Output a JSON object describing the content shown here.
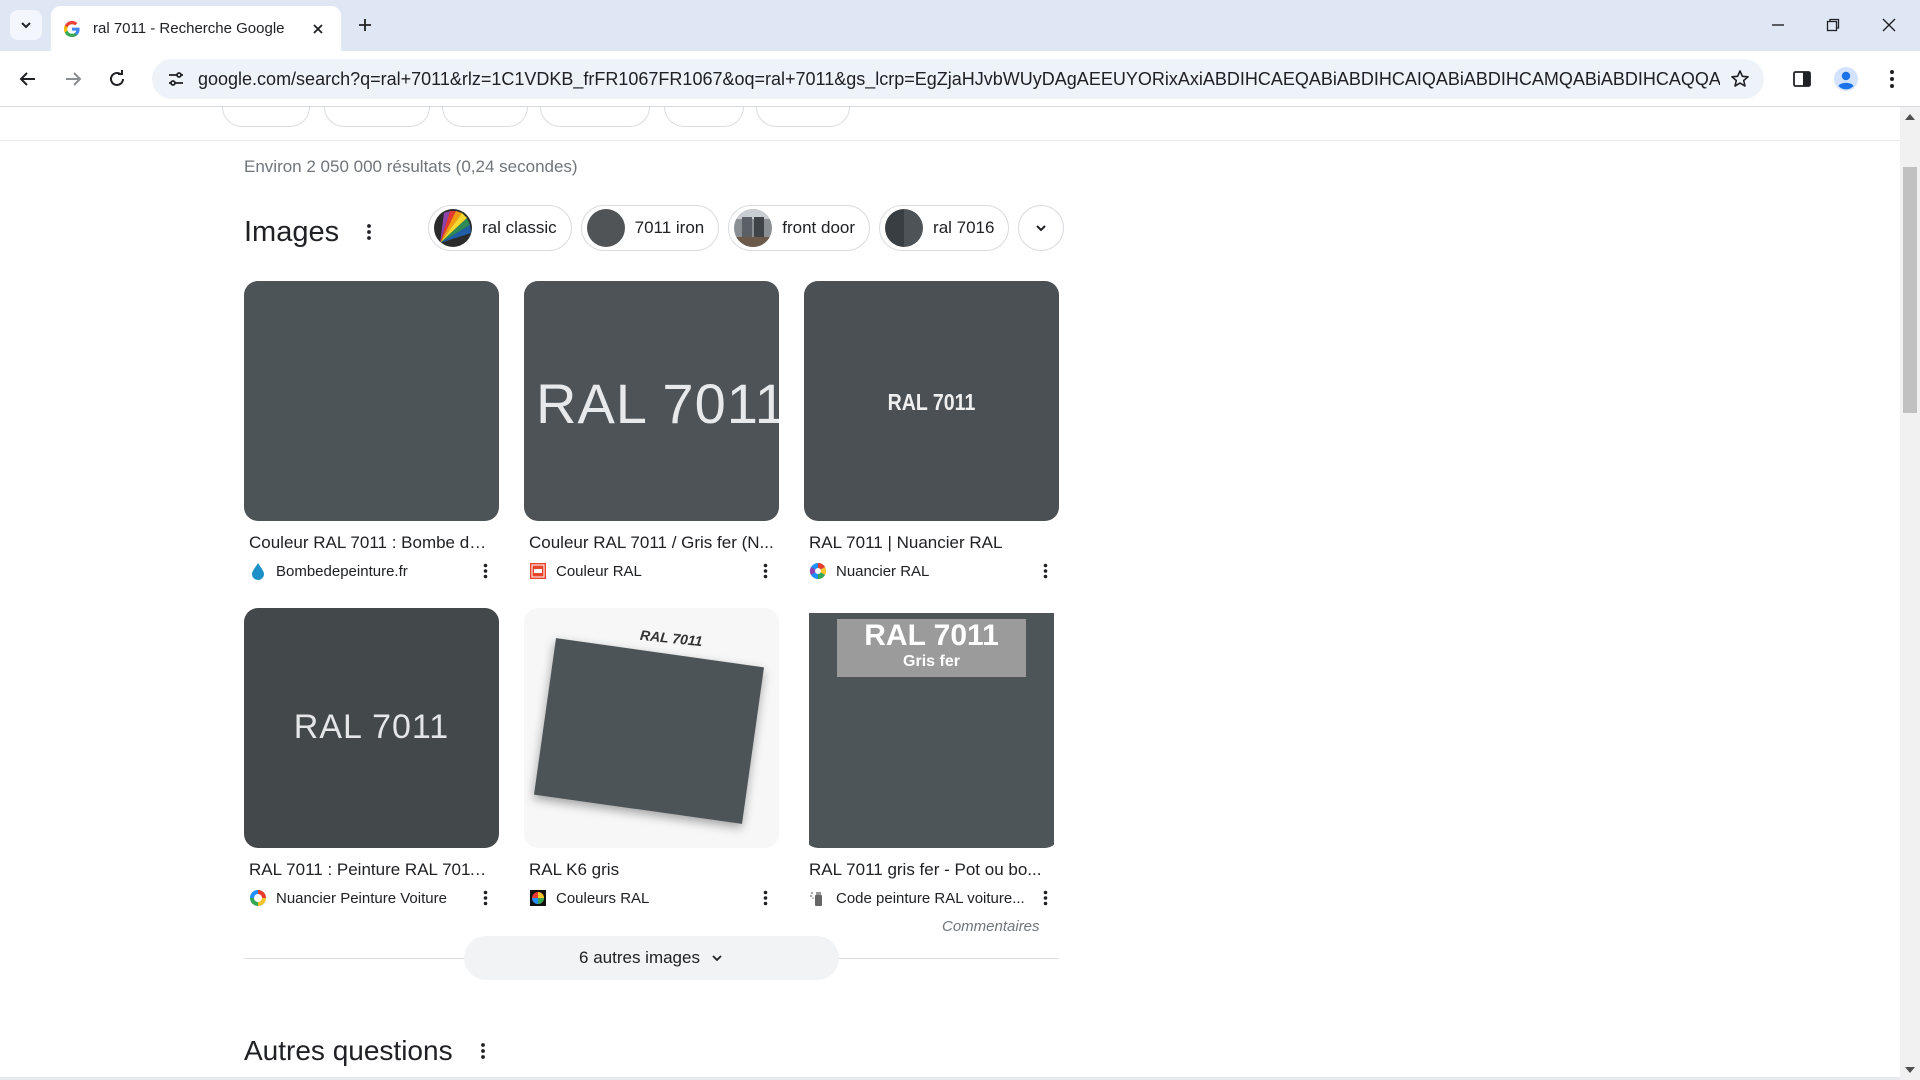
{
  "browser": {
    "tab_title": "ral 7011 - Recherche Google",
    "url": "google.com/search?q=ral+7011&rlz=1C1VDKB_frFR1067FR1067&oq=ral+7011&gs_lcrp=EgZjaHJvbWUyDAgAEEUYORixAxiABDIHCAEQABiABDIHCAIQABiABDIHCAMQABiABDIHCAQQABiABDIHCA..."
  },
  "results": {
    "stats": "Environ 2 050 000 résultats (0,24 secondes)"
  },
  "images": {
    "title": "Images",
    "chips": [
      {
        "label": "ral classic"
      },
      {
        "label": "7011 iron"
      },
      {
        "label": "front door"
      },
      {
        "label": "ral 7016"
      }
    ],
    "cards": [
      {
        "title": "Couleur RAL 7011 : Bombe de ...",
        "source": "Bombedepeinture.fr"
      },
      {
        "title": "Couleur RAL 7011 / Gris fer (N...",
        "source": "Couleur RAL",
        "thumb_text": "RAL 7011"
      },
      {
        "title": "RAL 7011 | Nuancier RAL",
        "source": "Nuancier RAL",
        "thumb_text": "RAL 7011"
      },
      {
        "title": "RAL 7011 : Peinture RAL 7011 (...",
        "source": "Nuancier Peinture Voiture",
        "thumb_text": "RAL 7011"
      },
      {
        "title": "RAL K6 gris",
        "source": "Couleurs RAL",
        "thumb_text": "RAL 7011"
      },
      {
        "title": "RAL 7011 gris fer - Pot ou bo...",
        "source": "Code peinture RAL voiture...",
        "thumb_text": "RAL 7011",
        "thumb_subtext": "Gris fer"
      }
    ],
    "feedback": "Commentaires",
    "more_button": "6 autres images"
  },
  "questions": {
    "title": "Autres questions"
  },
  "colors": {
    "ral7011": "#4d5457",
    "accent": "#1a73e8"
  }
}
